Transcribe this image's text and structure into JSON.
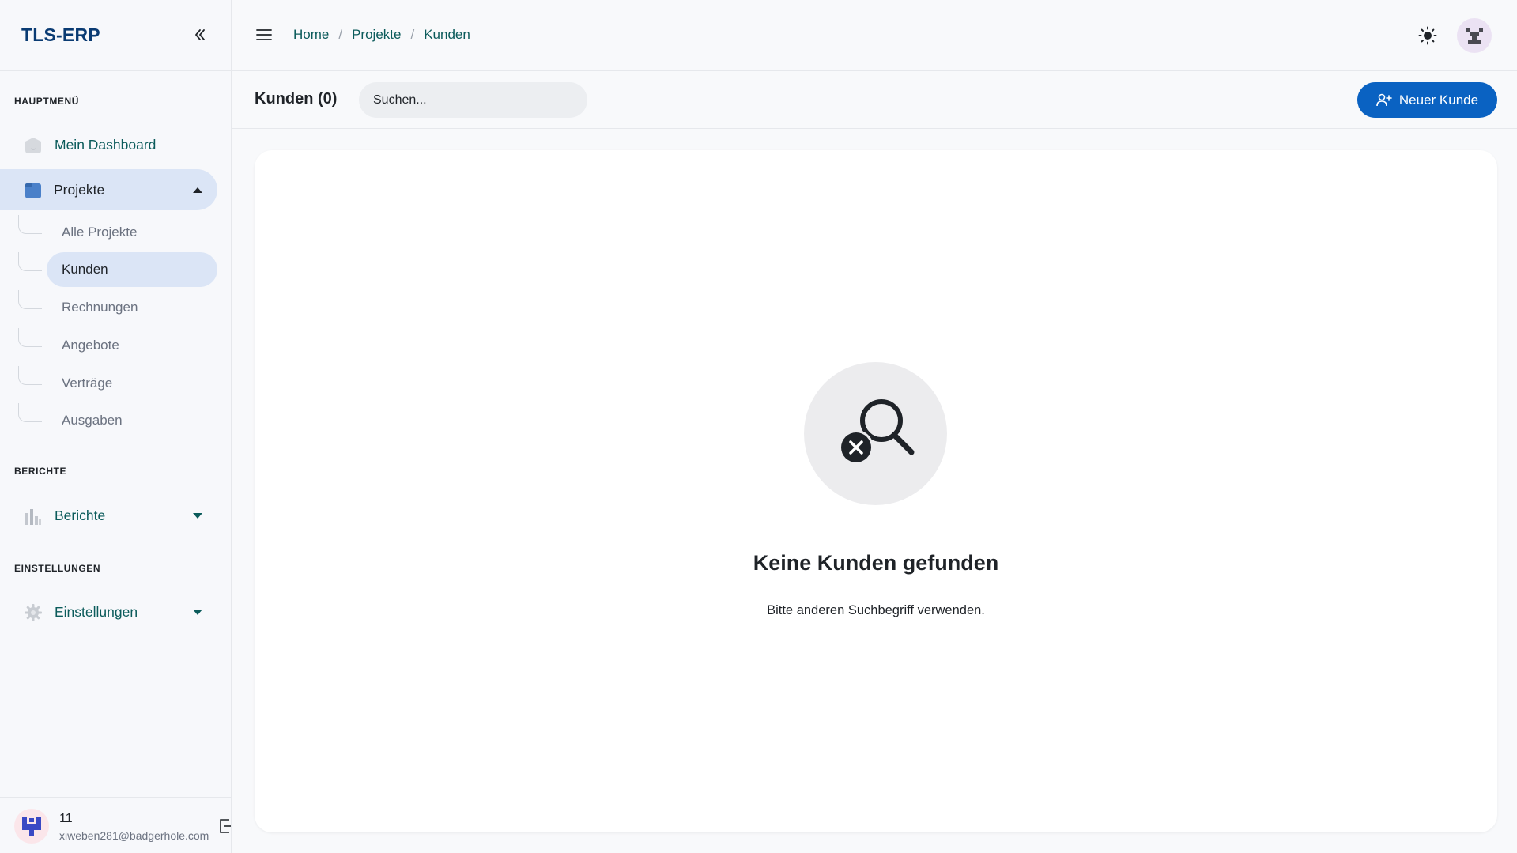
{
  "app": {
    "brand": "TLS-ERP"
  },
  "sidebar": {
    "sections": {
      "main": "HAUPTMENÜ",
      "reports": "BERICHTE",
      "settings": "EINSTELLUNGEN"
    },
    "dashboard": {
      "label": "Mein Dashboard",
      "icon": "dashboard-icon"
    },
    "projects": {
      "label": "Projekte",
      "icon": "folder-icon",
      "expanded": true,
      "items": [
        {
          "label": "Alle Projekte",
          "active": false
        },
        {
          "label": "Kunden",
          "active": true
        },
        {
          "label": "Rechnungen",
          "active": false
        },
        {
          "label": "Angebote",
          "active": false
        },
        {
          "label": "Verträge",
          "active": false
        },
        {
          "label": "Ausgaben",
          "active": false
        }
      ]
    },
    "reports": {
      "label": "Berichte",
      "icon": "bar-chart-icon"
    },
    "settings": {
      "label": "Einstellungen",
      "icon": "gear-icon"
    },
    "user": {
      "name": "11",
      "email": "xiweben281@badgerhole.com"
    }
  },
  "topbar": {
    "breadcrumb": [
      "Home",
      "Projekte",
      "Kunden"
    ]
  },
  "header": {
    "title": "Kunden (0)",
    "search_placeholder": "Suchen...",
    "new_button": "Neuer Kunde"
  },
  "empty_state": {
    "title": "Keine Kunden gefunden",
    "subtitle": "Bitte anderen Suchbegriff verwenden."
  },
  "colors": {
    "primary": "#0a62c2",
    "brand": "#0a3b73",
    "nav_text": "#0b5b5b",
    "active_bg": "#dbe5f6"
  }
}
